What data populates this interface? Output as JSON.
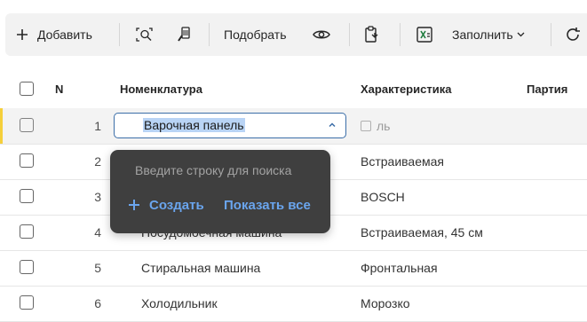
{
  "toolbar": {
    "add_label": "Добавить",
    "pick_label": "Подобрать",
    "fill_label": "Заполнить"
  },
  "table": {
    "headers": {
      "number": "N",
      "nomenclature": "Номенклатура",
      "characteristic": "Характеристика",
      "batch": "Партия"
    },
    "rows": [
      {
        "n": "1",
        "name": "Варочная панель",
        "characteristic": "ль"
      },
      {
        "n": "2",
        "name": "",
        "characteristic": "Встраиваемая"
      },
      {
        "n": "3",
        "name": "",
        "characteristic": "BOSCH"
      },
      {
        "n": "4",
        "name": "Посудомоечная машина",
        "characteristic": "Встраиваемая, 45 см"
      },
      {
        "n": "5",
        "name": "Стиральная машина",
        "characteristic": "Фронтальная"
      },
      {
        "n": "6",
        "name": "Холодильник",
        "characteristic": "Морозко"
      }
    ]
  },
  "editor": {
    "value": "Варочная панель"
  },
  "popup": {
    "hint": "Введите строку для поиска",
    "create_label": "Создать",
    "show_all_label": "Показать все"
  },
  "colors": {
    "accent_link": "#6aa5ee",
    "focus_border": "#3c6ea8",
    "active_marker": "#f5cf3b",
    "popup_bg": "#3f3f3f"
  }
}
